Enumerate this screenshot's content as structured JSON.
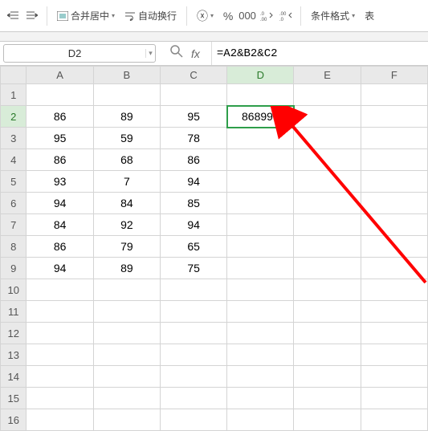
{
  "ribbon": {
    "merge_center": "合并居中",
    "wrap_text": "自动换行",
    "conditional_fmt": "条件格式",
    "table_btn": "表"
  },
  "namebox": {
    "value": "D2"
  },
  "formula": {
    "value": "=A2&B2&C2"
  },
  "columns": [
    "A",
    "B",
    "C",
    "D",
    "E",
    "F"
  ],
  "rows": [
    "1",
    "2",
    "3",
    "4",
    "5",
    "6",
    "7",
    "8",
    "9",
    "10",
    "11",
    "12",
    "13",
    "14",
    "15",
    "16"
  ],
  "selected": {
    "col": "D",
    "row": "2"
  },
  "chart_data": {
    "type": "table",
    "headers": [
      "A",
      "B",
      "C"
    ],
    "rows": [
      [
        86,
        89,
        95
      ],
      [
        95,
        59,
        78
      ],
      [
        86,
        68,
        86
      ],
      [
        93,
        7,
        94
      ],
      [
        94,
        84,
        85
      ],
      [
        84,
        92,
        94
      ],
      [
        86,
        79,
        65
      ],
      [
        94,
        89,
        75
      ]
    ]
  },
  "d2_value": "868995",
  "icons": {
    "indent_dec": "indent-decrease-icon",
    "indent_inc": "indent-increase-icon",
    "currency": "currency-icon",
    "percent": "percent-icon",
    "comma": "comma-icon",
    "inc_dec": "increase-decimal-icon",
    "dec_dec": "decrease-decimal-icon",
    "zoom": "zoom-icon",
    "fx": "fx-icon"
  }
}
